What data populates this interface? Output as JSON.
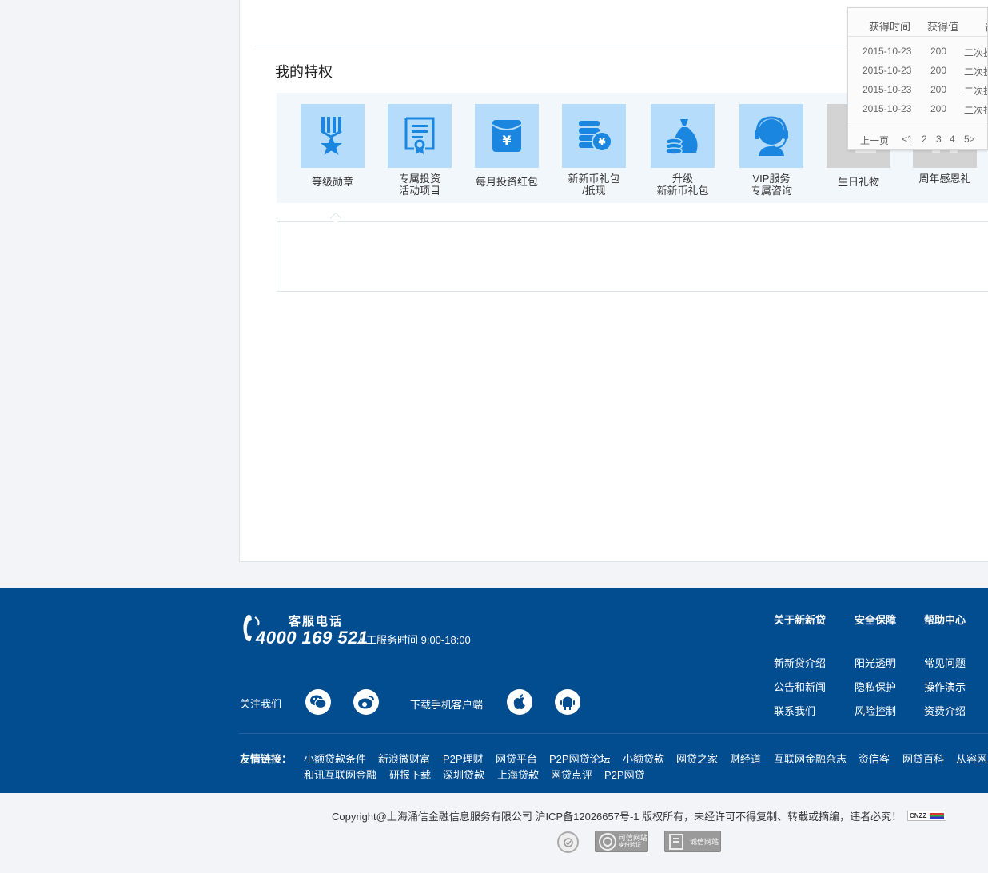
{
  "privileges": {
    "title": "我的特权",
    "items": [
      {
        "line1": "等级勋章",
        "line2": ""
      },
      {
        "line1": "专属投资",
        "line2": "活动项目"
      },
      {
        "line1": "每月投资红包",
        "line2": ""
      },
      {
        "line1": "新新币礼包",
        "line2": "/抵现"
      },
      {
        "line1": "升级",
        "line2": "新新币礼包"
      },
      {
        "line1": "VIP服务",
        "line2": "专属咨询"
      },
      {
        "line1": "生日礼物",
        "line2": ""
      },
      {
        "line1": "周年感恩礼",
        "line2": ""
      }
    ]
  },
  "popup": {
    "headers": [
      "获得时间",
      "获得值",
      "备"
    ],
    "rows": [
      {
        "date": "2015-10-23",
        "value": "200",
        "note": "二次投"
      },
      {
        "date": "2015-10-23",
        "value": "200",
        "note": "二次投"
      },
      {
        "date": "2015-10-23",
        "value": "200",
        "note": "二次投"
      },
      {
        "date": "2015-10-23",
        "value": "200",
        "note": "二次投"
      }
    ],
    "pager": {
      "prev": "上一页",
      "p1": "<1",
      "p2": "2",
      "p3": "3",
      "p4": "4",
      "p5": "5>"
    }
  },
  "footer": {
    "hotline_label": "客服电话",
    "hotline_number": "4000 169 521",
    "service_hours": "人工服务时间  9:00-18:00",
    "follow_us": "关注我们",
    "download_app": "下载手机客户端",
    "columns": [
      {
        "title": "关于新新贷",
        "links": [
          "新新贷介绍",
          "公告和新闻",
          "联系我们"
        ]
      },
      {
        "title": "安全保障",
        "links": [
          "阳光透明",
          "隐私保护",
          "风险控制"
        ]
      },
      {
        "title": "帮助中心",
        "links": [
          "常见问题",
          "操作演示",
          "资费介绍"
        ]
      }
    ],
    "friends_label": "友情链接：",
    "friends_row1": [
      "小额贷款条件",
      "新浪微财富",
      "P2P理财",
      "网贷平台",
      "P2P网贷论坛",
      "小额贷款",
      "网贷之家",
      "财经道",
      "互联网金融杂志",
      "资信客",
      "网贷百科",
      "从容网"
    ],
    "friends_row2": [
      "和讯互联网金融",
      "研报下载",
      "深圳贷款",
      "上海贷款",
      "网贷点评",
      "P2P网贷"
    ]
  },
  "bottom": {
    "copyright": "Copyright@上海涌信金融信息服务有限公司 沪ICP备12026657号-1 版权所有，未经许可不得复制、转载或摘编，违者必究！",
    "badge_cnzz": "CNZZ",
    "badge_trusted": "可信网站",
    "badge_trusted_sub": "身份验证",
    "badge_integrity": "诚信网站"
  }
}
